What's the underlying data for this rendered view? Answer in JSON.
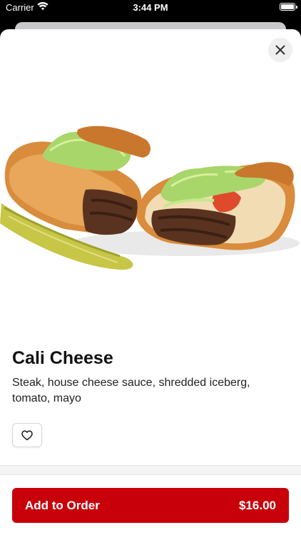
{
  "status_bar": {
    "carrier": "Carrier",
    "time": "3:44 PM",
    "battery_level": 1.0
  },
  "item": {
    "name": "Cali Cheese",
    "description": "Steak, house cheese sauce, shredded iceberg, tomato, mayo",
    "image_alt": "Cali Cheese sandwich with pickle spear"
  },
  "actions": {
    "add_to_order_label": "Add to Order",
    "price": "$16.00"
  },
  "colors": {
    "accent": "#c8000a",
    "background": "#ffffff"
  },
  "icons": {
    "close": "close-icon",
    "favorite": "heart-outline-icon",
    "wifi": "wifi-icon",
    "battery": "battery-icon"
  }
}
